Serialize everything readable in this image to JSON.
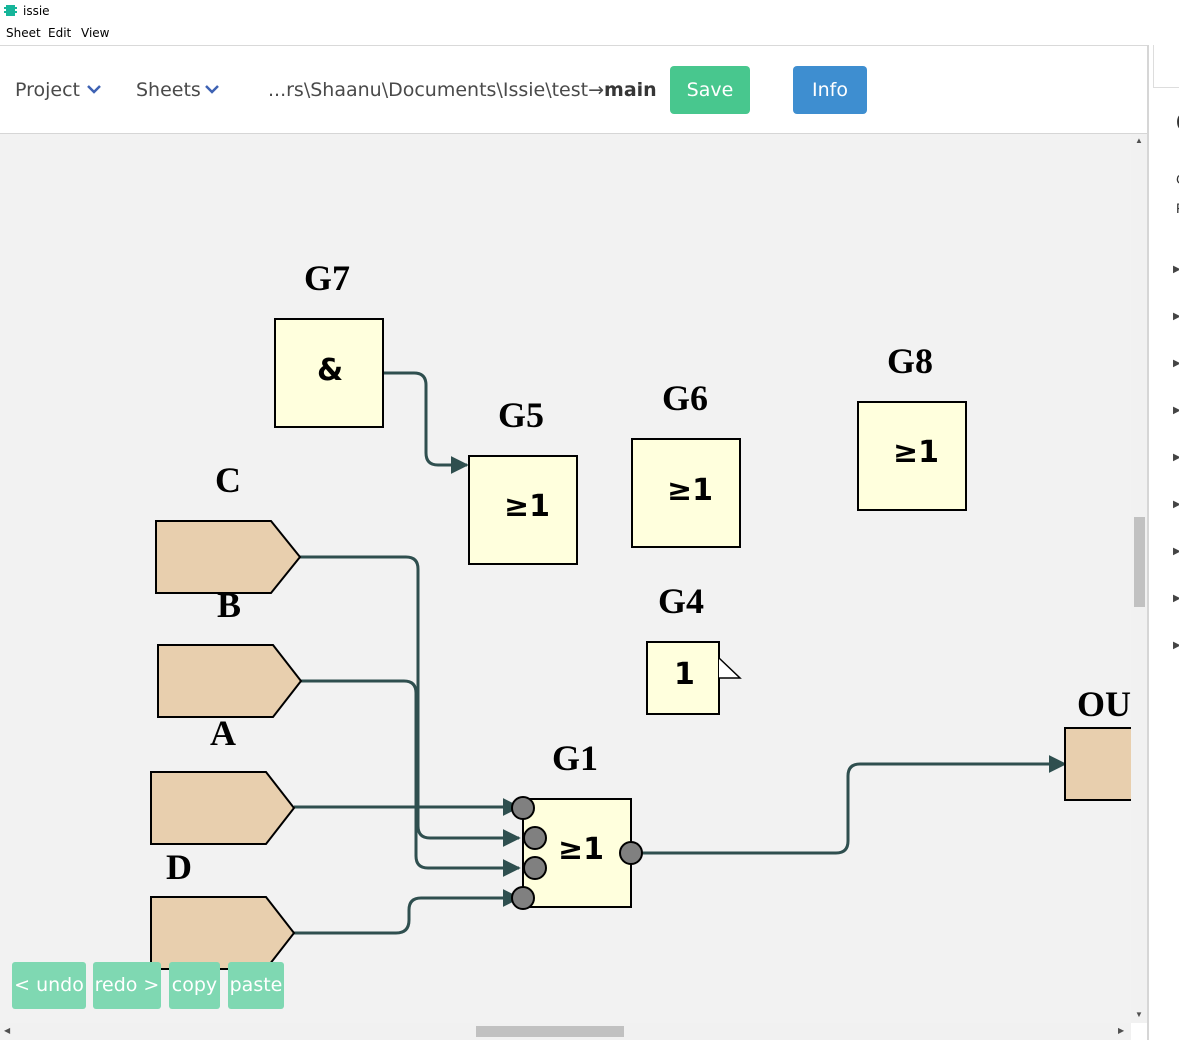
{
  "window": {
    "title": "issie"
  },
  "menu": [
    "Sheet",
    "Edit",
    "View"
  ],
  "toolbar": {
    "project_label": "Project",
    "sheets_label": "Sheets",
    "path_prefix": "...rs\\Shaanu\\Documents\\Issie\\test",
    "path_arrow": "→",
    "path_sheet": "main",
    "save_label": "Save",
    "info_label": "Info"
  },
  "canvas": {
    "components": {
      "g7": {
        "label": "G7",
        "symbol": "&"
      },
      "g5": {
        "label": "G5",
        "symbol": "≥1"
      },
      "g6": {
        "label": "G6",
        "symbol": "≥1"
      },
      "g8": {
        "label": "G8",
        "symbol": "≥1"
      },
      "g4": {
        "label": "G4",
        "symbol": "1"
      },
      "g1": {
        "label": "G1",
        "symbol": "≥1"
      },
      "input_c": {
        "label": "C"
      },
      "input_b": {
        "label": "B"
      },
      "input_a": {
        "label": "A"
      },
      "input_d": {
        "label": "D"
      },
      "output": {
        "label": "OU"
      }
    }
  },
  "edit_buttons": {
    "undo": "< undo",
    "redo": "redo >",
    "copy": "copy",
    "paste": "paste"
  },
  "right_panel": {
    "heading_char": "C",
    "line1": "C",
    "line2": "F",
    "triangles": 9
  },
  "colors": {
    "gate_fill": "#ffffdd",
    "io_fill": "#e8cfae",
    "wire": "#2f4f4f",
    "save": "#48c78e",
    "info": "#3e8ed0",
    "edit_buttons": "#7fd8b2"
  }
}
